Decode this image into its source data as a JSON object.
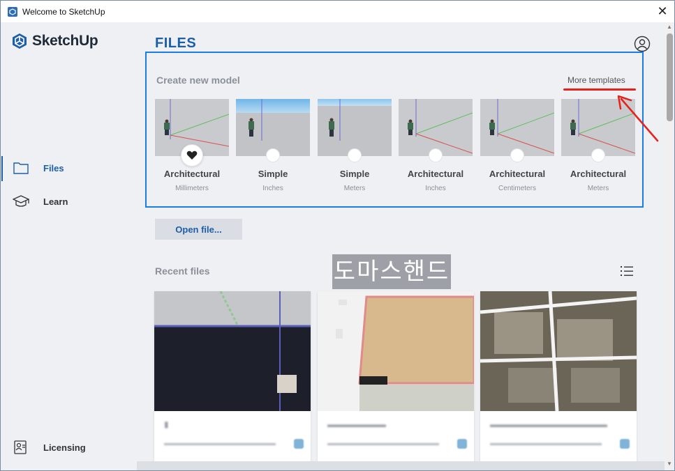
{
  "window": {
    "title": "Welcome to SketchUp"
  },
  "sidebar": {
    "logo_text": "SketchUp",
    "items": [
      {
        "label": "Files",
        "icon": "folder-icon",
        "active": true
      },
      {
        "label": "Learn",
        "icon": "graduation-cap-icon",
        "active": false
      },
      {
        "label": "Licensing",
        "icon": "license-icon",
        "active": false
      }
    ]
  },
  "main": {
    "title": "FILES",
    "create_label": "Create new model",
    "more_templates": "More templates",
    "templates": [
      {
        "name": "Architectural",
        "unit": "Millimeters",
        "favorite": true
      },
      {
        "name": "Simple",
        "unit": "Inches",
        "favorite": false
      },
      {
        "name": "Simple",
        "unit": "Meters",
        "favorite": false
      },
      {
        "name": "Architectural",
        "unit": "Inches",
        "favorite": false
      },
      {
        "name": "Architectural",
        "unit": "Centimeters",
        "favorite": false
      },
      {
        "name": "Architectural",
        "unit": "Meters",
        "favorite": false
      }
    ],
    "open_file": "Open file...",
    "recent_label": "Recent files",
    "overlay_text": "도마스핸드"
  },
  "colors": {
    "accent": "#1c5fa8",
    "highlight_box": "#1a7de6",
    "annotation": "#e8201a"
  }
}
